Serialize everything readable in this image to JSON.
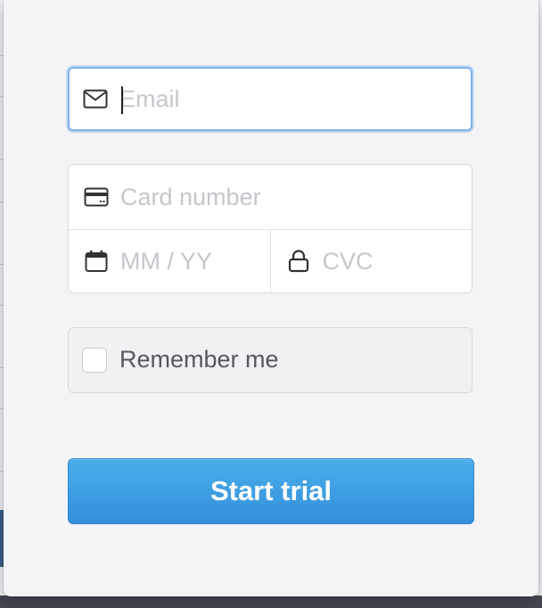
{
  "form": {
    "email": {
      "placeholder": "Email",
      "value": "",
      "icon": "envelope-icon"
    },
    "card_number": {
      "placeholder": "Card number",
      "value": "",
      "icon": "credit-card-icon"
    },
    "expiry": {
      "placeholder": "MM / YY",
      "value": "",
      "icon": "calendar-icon"
    },
    "cvc": {
      "placeholder": "CVC",
      "value": "",
      "icon": "lock-icon"
    },
    "remember": {
      "label": "Remember me",
      "checked": false
    },
    "submit": {
      "label": "Start trial"
    }
  },
  "colors": {
    "accent": "#3a9be3",
    "focus_ring": "#7fb0ee",
    "placeholder": "#c6c6cc",
    "modal_background": "#f4f4f6"
  }
}
